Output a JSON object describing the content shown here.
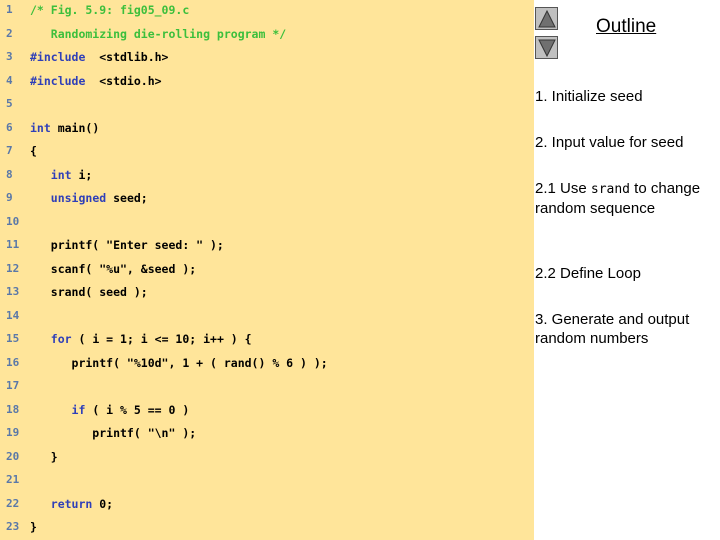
{
  "code_lines": [
    {
      "n": "1",
      "segs": [
        [
          "c",
          "/* Fig. 5.9: fig05_09.c"
        ]
      ]
    },
    {
      "n": "2",
      "segs": [
        [
          "c",
          "   Randomizing die-rolling program */"
        ]
      ]
    },
    {
      "n": "3",
      "segs": [
        [
          "k",
          "#include"
        ],
        [
          "",
          "  <stdlib.h>"
        ]
      ]
    },
    {
      "n": "4",
      "segs": [
        [
          "k",
          "#include"
        ],
        [
          "",
          "  <stdio.h>"
        ]
      ]
    },
    {
      "n": "5",
      "segs": []
    },
    {
      "n": "6",
      "segs": [
        [
          "k",
          "int"
        ],
        [
          "",
          " main()"
        ]
      ]
    },
    {
      "n": "7",
      "segs": [
        [
          "",
          "{"
        ]
      ]
    },
    {
      "n": "8",
      "segs": [
        [
          "",
          "   "
        ],
        [
          "k",
          "int"
        ],
        [
          "",
          " i;"
        ]
      ]
    },
    {
      "n": "9",
      "segs": [
        [
          "",
          "   "
        ],
        [
          "k",
          "unsigned"
        ],
        [
          "",
          " seed;"
        ]
      ]
    },
    {
      "n": "10",
      "segs": []
    },
    {
      "n": "11",
      "segs": [
        [
          "",
          "   printf( \"Enter seed: \" );"
        ]
      ]
    },
    {
      "n": "12",
      "segs": [
        [
          "",
          "   scanf( \"%u\", &seed );"
        ]
      ]
    },
    {
      "n": "13",
      "segs": [
        [
          "",
          "   srand( seed );"
        ]
      ]
    },
    {
      "n": "14",
      "segs": []
    },
    {
      "n": "15",
      "segs": [
        [
          "",
          "   "
        ],
        [
          "k",
          "for"
        ],
        [
          "",
          " ( i = 1; i <= 10; i++ ) {"
        ]
      ]
    },
    {
      "n": "16",
      "segs": [
        [
          "",
          "      printf( \"%10d\", 1 + ( rand() % 6 ) );"
        ]
      ]
    },
    {
      "n": "17",
      "segs": []
    },
    {
      "n": "18",
      "segs": [
        [
          "",
          "      "
        ],
        [
          "k",
          "if"
        ],
        [
          "",
          " ( i % 5 == 0 )"
        ]
      ]
    },
    {
      "n": "19",
      "segs": [
        [
          "",
          "         printf( \"\\n\" );"
        ]
      ]
    },
    {
      "n": "20",
      "segs": [
        [
          "",
          "   }"
        ]
      ]
    },
    {
      "n": "21",
      "segs": []
    },
    {
      "n": "22",
      "segs": [
        [
          "",
          "   "
        ],
        [
          "k",
          "return"
        ],
        [
          "",
          " 0;"
        ]
      ]
    },
    {
      "n": "23",
      "segs": [
        [
          "",
          "}"
        ]
      ]
    }
  ],
  "outline": {
    "title": "Outline",
    "step1": "1.  Initialize seed",
    "step2": "2.  Input value for seed",
    "step21_pre": "2.1  Use ",
    "step21_code": "srand",
    "step21_post": " to change random sequence",
    "step22": "2.2  Define Loop",
    "step3": "3.  Generate and output random numbers"
  },
  "icons": {
    "prev": "triangle-up-icon",
    "next": "triangle-down-icon"
  }
}
